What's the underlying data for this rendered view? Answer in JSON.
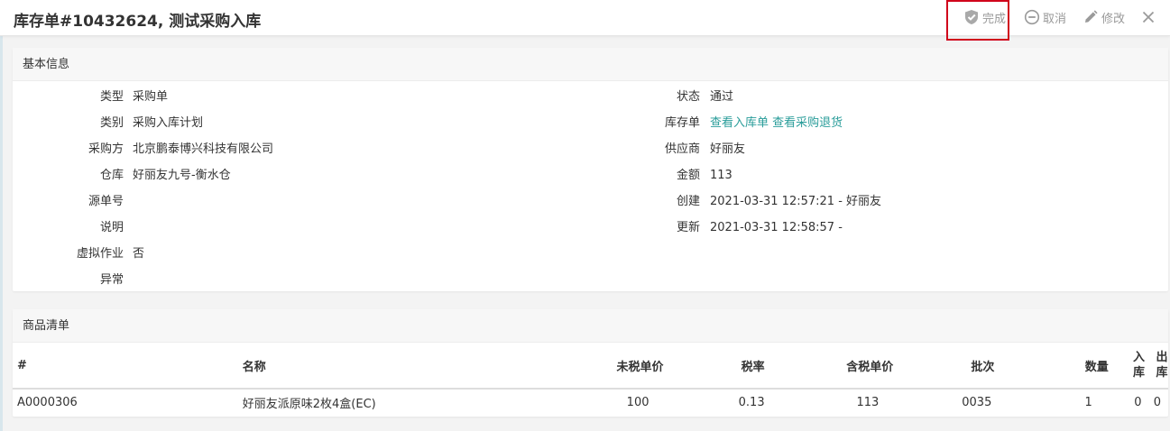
{
  "header": {
    "title": "库存单#10432624, 测试采购入库",
    "actions": {
      "done": "完成",
      "cancel": "取消",
      "edit": "修改"
    }
  },
  "basic_info": {
    "heading": "基本信息",
    "left": [
      {
        "label": "类型",
        "value": "采购单"
      },
      {
        "label": "类别",
        "value": "采购入库计划"
      },
      {
        "label": "采购方",
        "value": "北京鹏泰博兴科技有限公司"
      },
      {
        "label": "仓库",
        "value": "好丽友九号-衡水仓"
      },
      {
        "label": "源单号",
        "value": ""
      },
      {
        "label": "说明",
        "value": ""
      },
      {
        "label": "虚拟作业",
        "value": "否"
      },
      {
        "label": "异常",
        "value": ""
      }
    ],
    "right": [
      {
        "label": "状态",
        "value": "通过"
      },
      {
        "label": "库存单",
        "links": [
          "查看入库单",
          "查看采购退货"
        ]
      },
      {
        "label": "供应商",
        "value": "好丽友"
      },
      {
        "label": "金额",
        "value": "113"
      },
      {
        "label": "创建",
        "value": "2021-03-31 12:57:21 - 好丽友"
      },
      {
        "label": "更新",
        "value": "2021-03-31 12:58:57 -"
      }
    ]
  },
  "goods": {
    "heading": "商品清单",
    "columns": {
      "num": "#",
      "name": "名称",
      "price_ex_tax": "未税单价",
      "tax_rate": "税率",
      "price_inc_tax": "含税单价",
      "batch": "批次",
      "qty": "数量",
      "in_top": "入",
      "in_bottom": "库",
      "out_top": "出",
      "out_bottom": "库"
    },
    "rows": [
      {
        "num": "A0000306",
        "name": "好丽友派原味2枚4盒(EC)",
        "price_ex_tax": "100",
        "tax_rate": "0.13",
        "price_inc_tax": "113",
        "batch": "0035",
        "qty": "1",
        "in": "0",
        "out": "0"
      }
    ]
  },
  "colors": {
    "link": "#2a9d9a",
    "highlight": "#d0021b",
    "muted": "#999999"
  }
}
